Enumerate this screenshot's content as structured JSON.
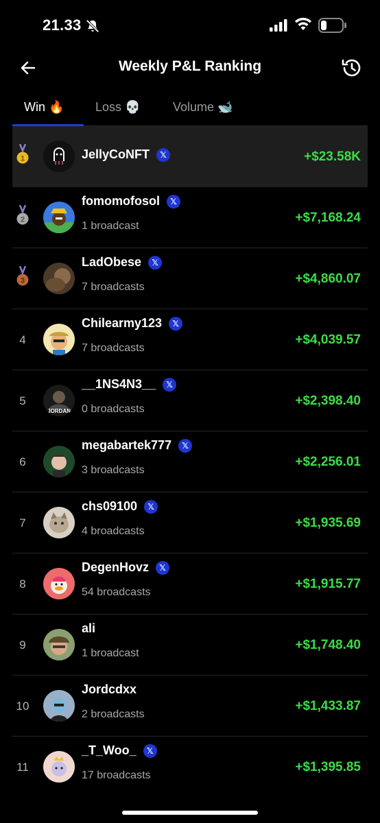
{
  "status": {
    "time": "21.33",
    "bell_icon": "bell-off-icon"
  },
  "header": {
    "title": "Weekly P&L Ranking",
    "back_icon": "arrow-left-icon",
    "history_icon": "history-icon"
  },
  "tabs": [
    {
      "label": "Win 🔥",
      "active": true
    },
    {
      "label": "Loss 💀",
      "active": false
    },
    {
      "label": "Volume 🐋",
      "active": false
    }
  ],
  "colors": {
    "profit": "#3ddc47",
    "accent": "#1f36d0",
    "gold": "#e8b923",
    "silver": "#a9a9a9",
    "bronze": "#b8683a"
  },
  "rankings": [
    {
      "rank": "1",
      "medal": "gold",
      "name": "JellyCoNFT",
      "verified": true,
      "broadcasts": "",
      "pnl": "+$23.58K"
    },
    {
      "rank": "2",
      "medal": "silver",
      "name": "fomomofosol",
      "verified": true,
      "broadcasts": "1 broadcast",
      "pnl": "+$7,168.24"
    },
    {
      "rank": "3",
      "medal": "bronze",
      "name": "LadObese",
      "verified": true,
      "broadcasts": "7 broadcasts",
      "pnl": "+$4,860.07"
    },
    {
      "rank": "4",
      "medal": "",
      "name": "Chilearmy123",
      "verified": true,
      "broadcasts": "7 broadcasts",
      "pnl": "+$4,039.57"
    },
    {
      "rank": "5",
      "medal": "",
      "name": "__1NS4N3__",
      "verified": true,
      "broadcasts": "0 broadcasts",
      "pnl": "+$2,398.40"
    },
    {
      "rank": "6",
      "medal": "",
      "name": "megabartek777",
      "verified": true,
      "broadcasts": "3 broadcasts",
      "pnl": "+$2,256.01"
    },
    {
      "rank": "7",
      "medal": "",
      "name": "chs09100",
      "verified": true,
      "broadcasts": "4 broadcasts",
      "pnl": "+$1,935.69"
    },
    {
      "rank": "8",
      "medal": "",
      "name": "DegenHovz",
      "verified": true,
      "broadcasts": "54 broadcasts",
      "pnl": "+$1,915.77"
    },
    {
      "rank": "9",
      "medal": "",
      "name": "ali",
      "verified": false,
      "broadcasts": "1 broadcast",
      "pnl": "+$1,748.40"
    },
    {
      "rank": "10",
      "medal": "",
      "name": "Jordcdxx",
      "verified": false,
      "broadcasts": "2 broadcasts",
      "pnl": "+$1,433.87"
    },
    {
      "rank": "11",
      "medal": "",
      "name": "_T_Woo_",
      "verified": true,
      "broadcasts": "17 broadcasts",
      "pnl": "+$1,395.85"
    }
  ]
}
